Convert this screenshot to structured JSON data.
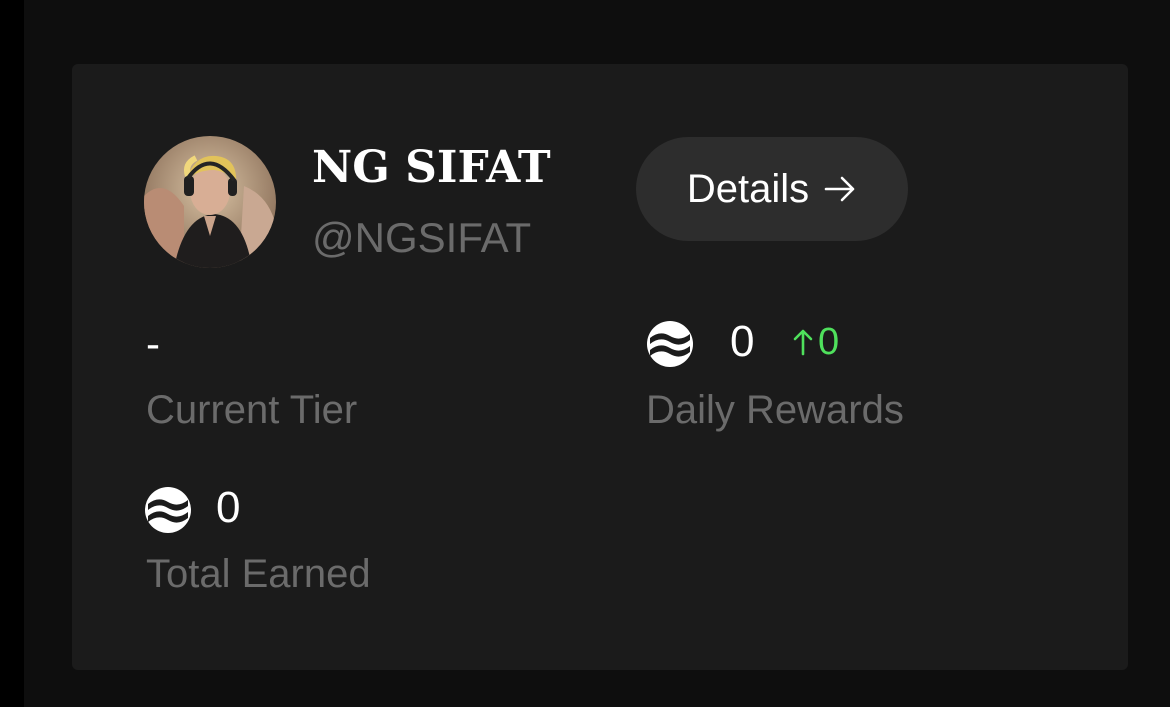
{
  "profile": {
    "display_name": "NG SIFAT",
    "handle": "@NGSIFAT",
    "avatar_icon": "user-avatar-photo"
  },
  "details_button": {
    "label": "Details",
    "icon": "arrow-right-icon"
  },
  "stats": {
    "current_tier": {
      "value": "-",
      "label": "Current Tier"
    },
    "daily_rewards": {
      "value": "0",
      "change": "0",
      "change_icon": "arrow-up-icon",
      "label": "Daily Rewards",
      "icon": "coin-icon"
    },
    "total_earned": {
      "value": "0",
      "label": "Total Earned",
      "icon": "coin-icon"
    }
  },
  "colors": {
    "background": "#0e0e0e",
    "card": "#1b1b1b",
    "button": "#2d2d2d",
    "muted_text": "#6b6b6b",
    "positive": "#4fe05c"
  }
}
